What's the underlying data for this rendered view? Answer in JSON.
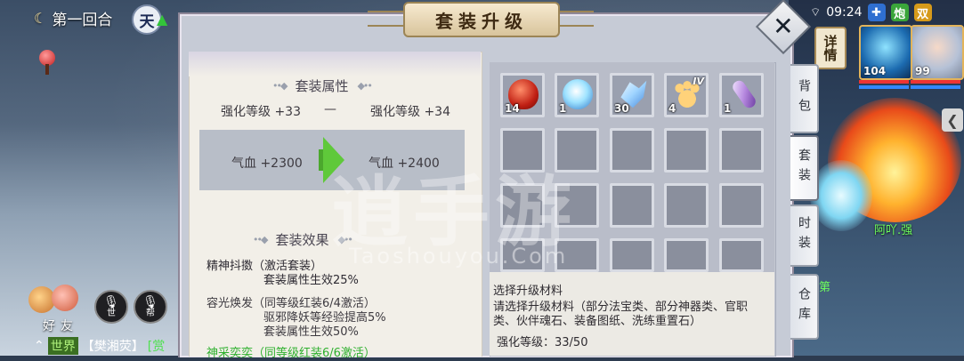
{
  "hud": {
    "round": "第一回合",
    "tian": "天",
    "time": "09:24",
    "status_icons": [
      "shield-icon",
      "炮",
      "双"
    ],
    "detail_label": "详情",
    "portraits": [
      {
        "level": "104"
      },
      {
        "level": "99"
      }
    ],
    "enemy_name": "阿吖.强",
    "side_text": "第",
    "friend_label": "好友",
    "voice_buttons": [
      "世",
      "帮"
    ],
    "chat": {
      "channel": "世界",
      "name": "【樊湘荧】",
      "suffix": "[赏"
    }
  },
  "panel": {
    "title": "套装升级",
    "close_label": "✕"
  },
  "attributes": {
    "section_title": "套装属性",
    "level_left": "强化等级 +33",
    "level_dash": "—",
    "level_right": "强化等级 +34",
    "hp_left": "气血  +2300",
    "hp_right": "气血  +2400"
  },
  "effects": {
    "section_title": "套装效果",
    "items": [
      {
        "name": "精神抖擞（激活套装）",
        "lines": [
          "套装属性生效25%"
        ]
      },
      {
        "name": "容光焕发（同等级红装6/4激活）",
        "lines": [
          "驱邪降妖等经验提高5%",
          "套装属性生效50%"
        ]
      },
      {
        "name": "神采奕奕（同等级红装6/6激活）",
        "lines": []
      }
    ]
  },
  "materials": {
    "slots": [
      {
        "icon": "ruby-icon",
        "count": "14"
      },
      {
        "icon": "crystal-orb-icon",
        "count": "1"
      },
      {
        "icon": "crystal-shard-icon",
        "count": "30"
      },
      {
        "icon": "paw-icon",
        "count": "4",
        "tier": "IV"
      },
      {
        "icon": "scroll-icon",
        "count": "1"
      }
    ],
    "select_title": "选择升级材料",
    "desc": "请选择升级材料（部分法宝类、部分神器类、官职类、伙伴魂石、装备图纸、洗练重置石）",
    "level_text": "强化等级：33/50"
  },
  "tabs": [
    {
      "label": "背包"
    },
    {
      "label": "套装"
    },
    {
      "label": "时装"
    },
    {
      "label": "仓库"
    }
  ],
  "watermark": {
    "big": "逍手游",
    "small": "Taoshouyou.Com"
  }
}
